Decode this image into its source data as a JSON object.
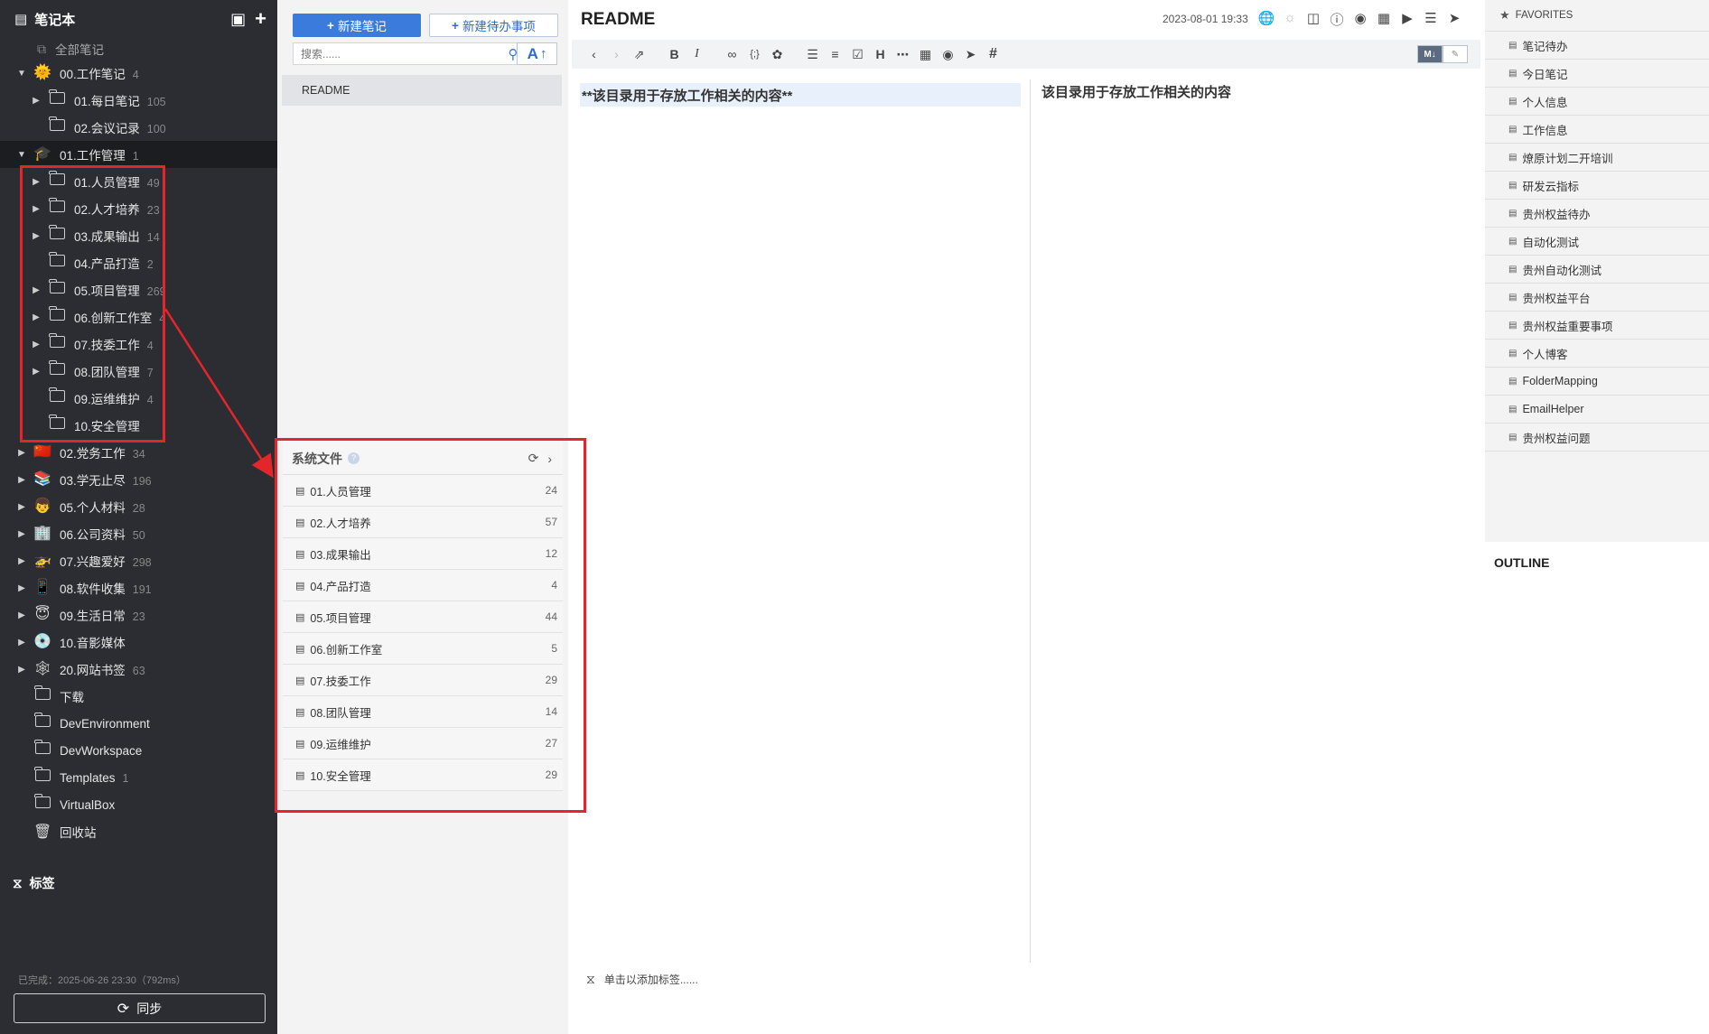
{
  "sidebar": {
    "title": "笔记本",
    "all_notes": "全部笔记",
    "tree": [
      {
        "label": "00.工作笔记",
        "count": "4",
        "icon": "sun-emoji",
        "emoji": "🌞",
        "level": 0,
        "arrow": "down"
      },
      {
        "label": "01.每日笔记",
        "count": "105",
        "icon": "folder",
        "level": 1,
        "arrow": "right"
      },
      {
        "label": "02.会议记录",
        "count": "100",
        "icon": "folder",
        "level": 1,
        "arrow": ""
      },
      {
        "label": "01.工作管理",
        "count": "1",
        "icon": "graduation-cap-emoji",
        "emoji": "🎓",
        "level": 0,
        "arrow": "down",
        "active": true
      },
      {
        "label": "01.人员管理",
        "count": "49",
        "icon": "folder",
        "level": 1,
        "arrow": "right"
      },
      {
        "label": "02.人才培养",
        "count": "23",
        "icon": "folder",
        "level": 1,
        "arrow": "right"
      },
      {
        "label": "03.成果输出",
        "count": "14",
        "icon": "folder",
        "level": 1,
        "arrow": "right"
      },
      {
        "label": "04.产品打造",
        "count": "2",
        "icon": "folder",
        "level": 1,
        "arrow": ""
      },
      {
        "label": "05.项目管理",
        "count": "269",
        "icon": "folder",
        "level": 1,
        "arrow": "right"
      },
      {
        "label": "06.创新工作室",
        "count": "4",
        "icon": "folder",
        "level": 1,
        "arrow": "right"
      },
      {
        "label": "07.技委工作",
        "count": "4",
        "icon": "folder",
        "level": 1,
        "arrow": "right"
      },
      {
        "label": "08.团队管理",
        "count": "7",
        "icon": "folder",
        "level": 1,
        "arrow": "right"
      },
      {
        "label": "09.运维维护",
        "count": "4",
        "icon": "folder",
        "level": 1,
        "arrow": ""
      },
      {
        "label": "10.安全管理",
        "count": "",
        "icon": "folder",
        "level": 1,
        "arrow": ""
      },
      {
        "label": "02.党务工作",
        "count": "34",
        "icon": "china-flag-emoji",
        "emoji": "🇨🇳",
        "level": 0,
        "arrow": "right"
      },
      {
        "label": "03.学无止尽",
        "count": "196",
        "icon": "books-emoji",
        "emoji": "📚",
        "level": 0,
        "arrow": "right"
      },
      {
        "label": "05.个人材料",
        "count": "28",
        "icon": "person-emoji",
        "emoji": "👦",
        "level": 0,
        "arrow": "right"
      },
      {
        "label": "06.公司资料",
        "count": "50",
        "icon": "office-building-emoji",
        "emoji": "🏢",
        "level": 0,
        "arrow": "right"
      },
      {
        "label": "07.兴趣爱好",
        "count": "298",
        "icon": "helicopter-emoji",
        "emoji": "🚁",
        "level": 0,
        "arrow": "right"
      },
      {
        "label": "08.软件收集",
        "count": "191",
        "icon": "mobile-phone-emoji",
        "emoji": "📱",
        "level": 0,
        "arrow": "right"
      },
      {
        "label": "09.生活日常",
        "count": "23",
        "icon": "halo-face-emoji",
        "emoji": "😇",
        "level": 0,
        "arrow": "right"
      },
      {
        "label": "10.音影媒体",
        "count": "",
        "icon": "dvd-emoji",
        "emoji": "💿",
        "level": 0,
        "arrow": "right"
      },
      {
        "label": "20.网站书签",
        "count": "63",
        "icon": "spider-web-emoji",
        "emoji": "🕸",
        "level": 0,
        "arrow": "right"
      },
      {
        "label": "下载",
        "count": "",
        "icon": "folder",
        "level": 0,
        "arrow": ""
      },
      {
        "label": "DevEnvironment",
        "count": "",
        "icon": "folder",
        "level": 0,
        "arrow": ""
      },
      {
        "label": "DevWorkspace",
        "count": "",
        "icon": "folder",
        "level": 0,
        "arrow": ""
      },
      {
        "label": "Templates",
        "count": "1",
        "icon": "folder",
        "level": 0,
        "arrow": ""
      },
      {
        "label": "VirtualBox",
        "count": "",
        "icon": "folder",
        "level": 0,
        "arrow": ""
      },
      {
        "label": "回收站",
        "count": "",
        "icon": "trash",
        "level": 0,
        "arrow": ""
      }
    ],
    "tags_label": "标签",
    "status": "已完成：2025-06-26 23:30（792ms）",
    "sync_label": "同步"
  },
  "middle": {
    "new_note": "新建笔记",
    "new_todo": "新建待办事项",
    "search_placeholder": "搜索......",
    "note_title": "README",
    "sys_panel": {
      "title": "系统文件",
      "items": [
        {
          "label": "01.人员管理",
          "count": "24"
        },
        {
          "label": "02.人才培养",
          "count": "57"
        },
        {
          "label": "03.成果输出",
          "count": "12"
        },
        {
          "label": "04.产品打造",
          "count": "4"
        },
        {
          "label": "05.项目管理",
          "count": "44"
        },
        {
          "label": "06.创新工作室",
          "count": "5"
        },
        {
          "label": "07.技委工作",
          "count": "29"
        },
        {
          "label": "08.团队管理",
          "count": "14"
        },
        {
          "label": "09.运维维护",
          "count": "27"
        },
        {
          "label": "10.安全管理",
          "count": "29"
        }
      ]
    }
  },
  "editor": {
    "title": "README",
    "date": "2023-08-01 19:33",
    "source_text": "**该目录用于存放工作相关的内容**",
    "preview_text": "该目录用于存放工作相关的内容",
    "tag_placeholder": "单击以添加标签......",
    "md_label": "M↓"
  },
  "right": {
    "favorites_label": "FAVORITES",
    "favorites": [
      "笔记待办",
      "今日笔记",
      "个人信息",
      "工作信息",
      "燎原计划二开培训",
      "研发云指标",
      "贵州权益待办",
      "自动化测试",
      "贵州自动化测试",
      "贵州权益平台",
      "贵州权益重要事项",
      "个人博客",
      "FolderMapping",
      "EmailHelper",
      "贵州权益问题"
    ],
    "outline_label": "OUTLINE"
  },
  "colors": {
    "sidebar_bg": "#2b2d33",
    "accent": "#3a7bdc",
    "annotation_red": "#e4262b"
  }
}
